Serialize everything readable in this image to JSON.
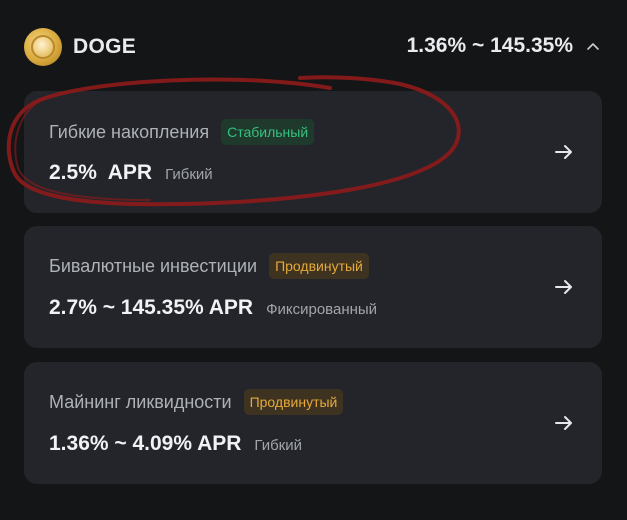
{
  "header": {
    "coin_name": "DOGE",
    "apr_range": "1.36% ~ 145.35%"
  },
  "products": [
    {
      "title": "Гибкие накопления",
      "badge": "Стабильный",
      "rate": "2.5%  APR",
      "type": "Гибкий"
    },
    {
      "title": "Бивалютные инвестиции",
      "badge": "Продвинутый",
      "rate": "2.7% ~ 145.35% APR",
      "type": "Фиксированный"
    },
    {
      "title": "Майнинг ликвидности",
      "badge": "Продвинутый",
      "rate": "1.36% ~ 4.09% APR",
      "type": "Гибкий"
    }
  ],
  "colors": {
    "background": "#141517",
    "card": "#23252a",
    "stable_badge_text": "#35c27e",
    "advanced_badge_text": "#e6a93a",
    "annotation_stroke": "#8e1b1b"
  },
  "icons": {
    "coin": "doge-coin-icon",
    "collapse": "chevron-up-icon",
    "open": "arrow-right-icon"
  }
}
